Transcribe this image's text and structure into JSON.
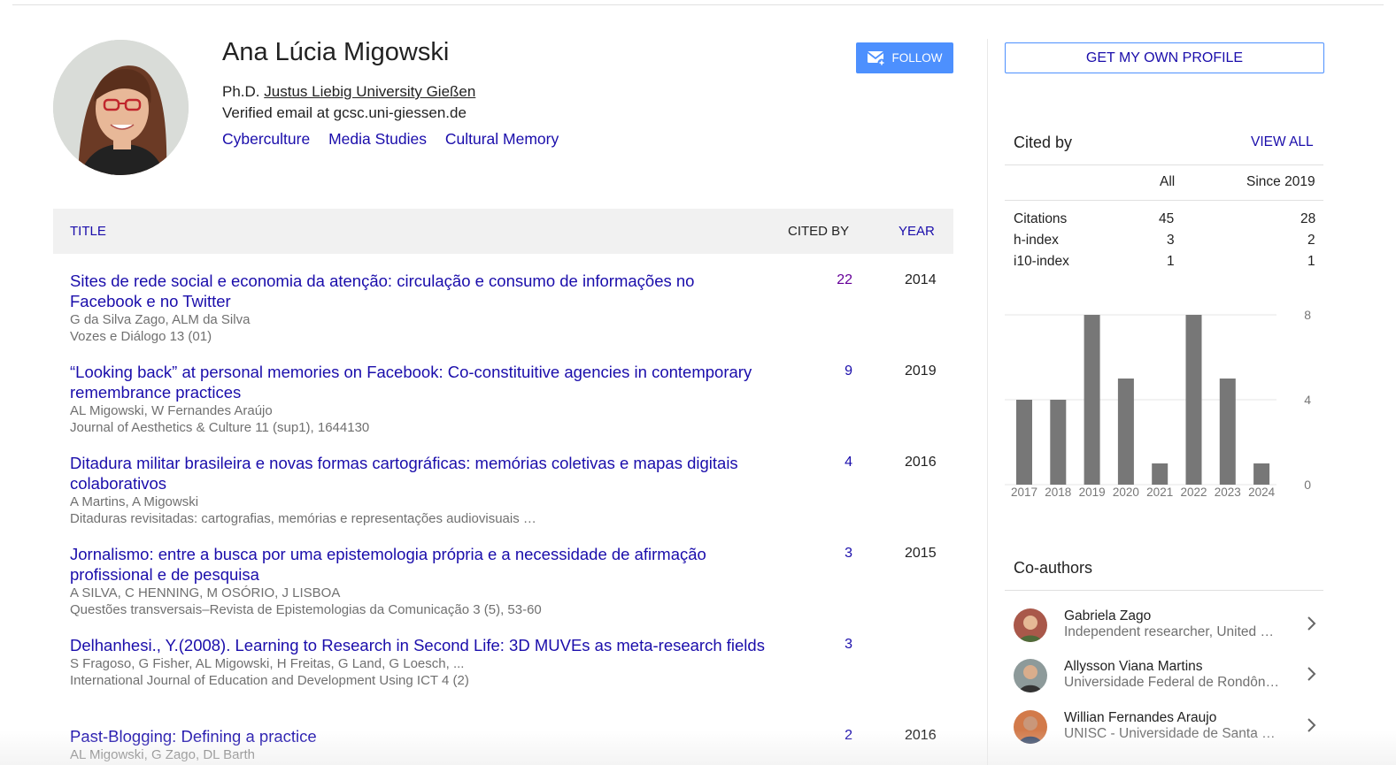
{
  "profile": {
    "name": "Ana Lúcia Migowski",
    "degree": "Ph.D.",
    "university": "Justus Liebig University Gießen",
    "email": "Verified email at gcsc.uni-giessen.de",
    "interests": [
      "Cyberculture",
      "Media Studies",
      "Cultural Memory"
    ],
    "follow_label": "FOLLOW"
  },
  "table": {
    "title_header": "TITLE",
    "cited_header": "CITED BY",
    "year_header": "YEAR",
    "rows": [
      {
        "title": "Sites de rede social e economia da atenção: circulação e consumo de informações no Facebook e no Twitter",
        "authors": "G da Silva Zago, ALM da Silva",
        "pub": "Vozes e Diálogo 13 (01)",
        "cited": "22",
        "year": "2014"
      },
      {
        "title": "“Looking back” at personal memories on Facebook: Co-constituitive agencies in contemporary remembrance practices",
        "authors": "AL Migowski, W Fernandes Araújo",
        "pub": "Journal of Aesthetics & Culture 11 (sup1), 1644130",
        "cited": "9",
        "year": "2019"
      },
      {
        "title": "Ditadura militar brasileira e novas formas cartográficas: memórias coletivas e mapas digitais colaborativos",
        "authors": "A Martins, A Migowski",
        "pub": "Ditaduras revisitadas: cartografias, memórias e representações audiovisuais …",
        "cited": "4",
        "year": "2016"
      },
      {
        "title": "Jornalismo: entre a busca por uma epistemologia própria e a necessidade de afirmação profissional e de pesquisa",
        "authors": "A SILVA, C HENNING, M OSÓRIO, J LISBOA",
        "pub": "Questões transversais–Revista de Epistemologias da Comunicação 3 (5), 53-60",
        "cited": "3",
        "year": "2015"
      },
      {
        "title": "Delhanhesi., Y.(2008). Learning to Research in Second Life: 3D MUVEs as meta-research fields",
        "authors": "S Fragoso, G Fisher, AL Migowski, H Freitas, G Land, G Loesch, ...",
        "pub": "International Journal of Education and Development Using ICT 4 (2)",
        "cited": "3",
        "year": ""
      },
      {
        "title": "Past-Blogging: Defining a practice",
        "authors": "AL Migowski, G Zago, DL Barth",
        "pub": "",
        "cited": "2",
        "year": "2016"
      }
    ]
  },
  "sidebar": {
    "get_profile_label": "GET MY OWN PROFILE",
    "cited_by_title": "Cited by",
    "view_all_label": "VIEW ALL",
    "col_all": "All",
    "col_since": "Since 2019",
    "stats": [
      {
        "label": "Citations",
        "all": "45",
        "since": "28"
      },
      {
        "label": "h-index",
        "all": "3",
        "since": "2"
      },
      {
        "label": "i10-index",
        "all": "1",
        "since": "1"
      }
    ],
    "coauthors_title": "Co-authors",
    "coauthors": [
      {
        "name": "Gabriela Zago",
        "affiliation": "Independent researcher, United …"
      },
      {
        "name": "Allysson Viana Martins",
        "affiliation": "Universidade Federal de Rondôn…"
      },
      {
        "name": "Willian Fernandes Araujo",
        "affiliation": "UNISC - Universidade de Santa …"
      }
    ]
  },
  "chart_data": {
    "type": "bar",
    "categories": [
      "2017",
      "2018",
      "2019",
      "2020",
      "2021",
      "2022",
      "2023",
      "2024"
    ],
    "values": [
      4,
      4,
      8,
      5,
      1,
      8,
      5,
      1
    ],
    "ylim": [
      0,
      8
    ],
    "yticks": [
      "0",
      "4",
      "8"
    ],
    "bar_color": "#777777",
    "grid": true
  }
}
